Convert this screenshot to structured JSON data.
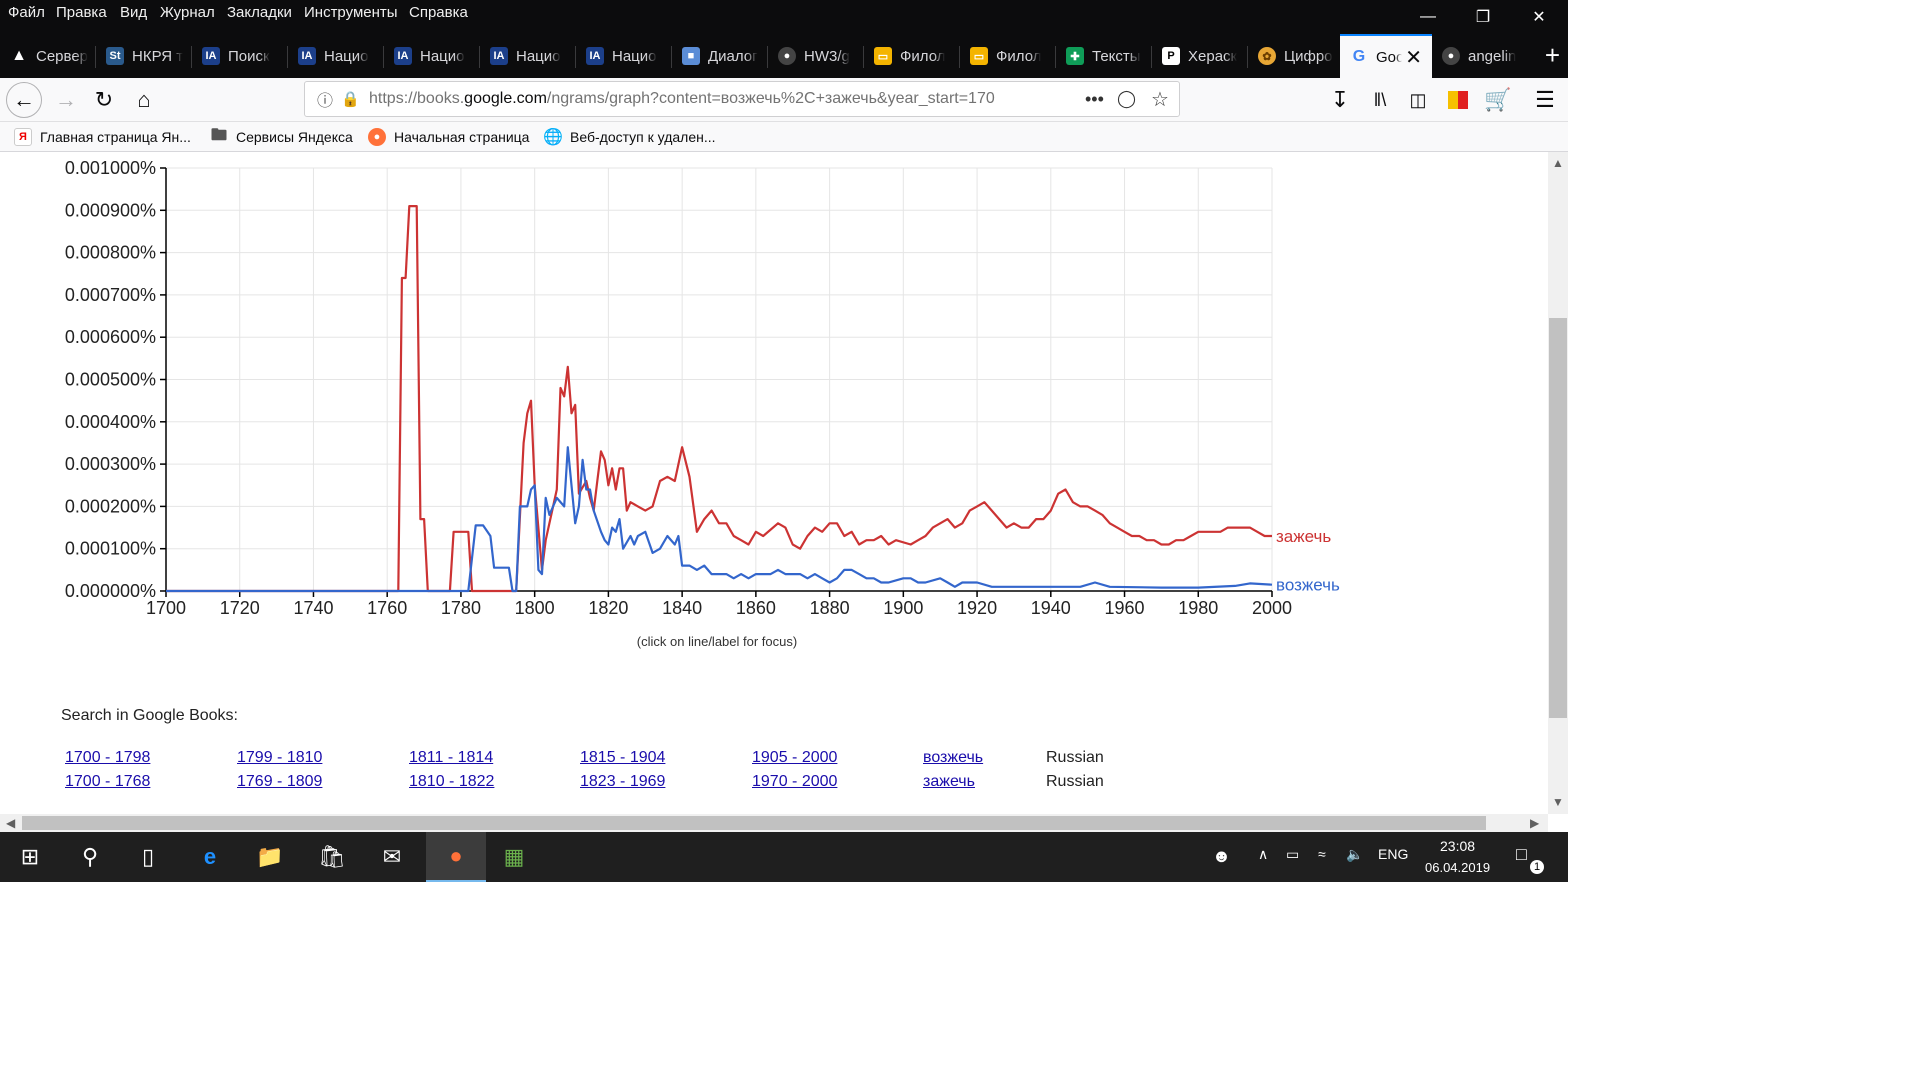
{
  "menu": [
    "Файл",
    "Правка",
    "Вид",
    "Журнал",
    "Закладки",
    "Инструменты",
    "Справка"
  ],
  "tabs": [
    {
      "label": "Сервер",
      "icon": "warning-icon"
    },
    {
      "label": "НКРЯ т",
      "icon": "st-icon"
    },
    {
      "label": "Поиск",
      "icon": "nkrya-icon"
    },
    {
      "label": "Нацио",
      "icon": "nkrya-icon"
    },
    {
      "label": "Нацио",
      "icon": "nkrya-icon"
    },
    {
      "label": "Нацио",
      "icon": "nkrya-icon"
    },
    {
      "label": "Нацио",
      "icon": "nkrya-icon"
    },
    {
      "label": "Диалог",
      "icon": "chat-icon"
    },
    {
      "label": "HW3/g",
      "icon": "github-icon"
    },
    {
      "label": "Филол",
      "icon": "slides-icon"
    },
    {
      "label": "Филол",
      "icon": "slides-icon"
    },
    {
      "label": "Тексты",
      "icon": "sheets-icon"
    },
    {
      "label": "Хераск",
      "icon": "doc-icon"
    },
    {
      "label": "Цифро",
      "icon": "brain-icon"
    },
    {
      "label": "Goo",
      "icon": "google-icon",
      "active": true
    },
    {
      "label": "angelin",
      "icon": "github-icon"
    }
  ],
  "url": {
    "prefix": "https://books.",
    "domain": "google.com",
    "path": "/ngrams/graph?content=возжечь%2C+зажечь&year_start=170"
  },
  "bookmarks": [
    {
      "label": "Главная страница Ян...",
      "icon": "yandex-icon"
    },
    {
      "label": "Сервисы Яндекса",
      "icon": "folder-icon"
    },
    {
      "label": "Начальная страница",
      "icon": "firefox-icon"
    },
    {
      "label": "Веб-доступ к удален...",
      "icon": "globe-icon"
    }
  ],
  "chart_data": {
    "type": "line",
    "x_ticks": [
      1700,
      1720,
      1740,
      1760,
      1780,
      1800,
      1820,
      1840,
      1860,
      1880,
      1900,
      1920,
      1940,
      1960,
      1980,
      2000
    ],
    "y_ticks": [
      "0.000000%",
      "0.000100%",
      "0.000200%",
      "0.000300%",
      "0.000400%",
      "0.000500%",
      "0.000600%",
      "0.000700%",
      "0.000800%",
      "0.000900%",
      "0.001000%"
    ],
    "xlim": [
      1700,
      2000
    ],
    "ylim": [
      0,
      0.001
    ],
    "grid": true,
    "note": "(click on line/label for focus)",
    "series": [
      {
        "name": "зажечь",
        "color": "#cc3333",
        "points": [
          [
            1700,
            0
          ],
          [
            1763,
            0
          ],
          [
            1764,
            0.00074
          ],
          [
            1765,
            0.00074
          ],
          [
            1766,
            0.00091
          ],
          [
            1768,
            0.00091
          ],
          [
            1769,
            0.00017
          ],
          [
            1770,
            0.00017
          ],
          [
            1771,
            0
          ],
          [
            1777,
            0
          ],
          [
            1778,
            0.00014
          ],
          [
            1782,
            0.00014
          ],
          [
            1783,
            0
          ],
          [
            1795,
            0
          ],
          [
            1797,
            0.00035
          ],
          [
            1798,
            0.00042
          ],
          [
            1799,
            0.00045
          ],
          [
            1800,
            0.00025
          ],
          [
            1802,
            5e-05
          ],
          [
            1803,
            0.00012
          ],
          [
            1806,
            0.00024
          ],
          [
            1807,
            0.00048
          ],
          [
            1808,
            0.00046
          ],
          [
            1809,
            0.00053
          ],
          [
            1810,
            0.00042
          ],
          [
            1811,
            0.00044
          ],
          [
            1812,
            0.00023
          ],
          [
            1814,
            0.00026
          ],
          [
            1815,
            0.00022
          ],
          [
            1816,
            0.00019
          ],
          [
            1817,
            0.00026
          ],
          [
            1818,
            0.00033
          ],
          [
            1819,
            0.00031
          ],
          [
            1820,
            0.00025
          ],
          [
            1821,
            0.00029
          ],
          [
            1822,
            0.00024
          ],
          [
            1823,
            0.00029
          ],
          [
            1824,
            0.00029
          ],
          [
            1825,
            0.00019
          ],
          [
            1826,
            0.00021
          ],
          [
            1828,
            0.0002
          ],
          [
            1830,
            0.00019
          ],
          [
            1832,
            0.0002
          ],
          [
            1834,
            0.00026
          ],
          [
            1836,
            0.00027
          ],
          [
            1838,
            0.00026
          ],
          [
            1840,
            0.00034
          ],
          [
            1842,
            0.00027
          ],
          [
            1844,
            0.00014
          ],
          [
            1846,
            0.00017
          ],
          [
            1848,
            0.00019
          ],
          [
            1850,
            0.00016
          ],
          [
            1852,
            0.00016
          ],
          [
            1854,
            0.00013
          ],
          [
            1856,
            0.00012
          ],
          [
            1858,
            0.00011
          ],
          [
            1860,
            0.00014
          ],
          [
            1862,
            0.00013
          ],
          [
            1866,
            0.00016
          ],
          [
            1868,
            0.00015
          ],
          [
            1870,
            0.00011
          ],
          [
            1872,
            0.0001
          ],
          [
            1874,
            0.00013
          ],
          [
            1876,
            0.00015
          ],
          [
            1878,
            0.00014
          ],
          [
            1880,
            0.00016
          ],
          [
            1882,
            0.00016
          ],
          [
            1884,
            0.00013
          ],
          [
            1886,
            0.00014
          ],
          [
            1888,
            0.00011
          ],
          [
            1890,
            0.00012
          ],
          [
            1892,
            0.00012
          ],
          [
            1894,
            0.00013
          ],
          [
            1896,
            0.00011
          ],
          [
            1898,
            0.00012
          ],
          [
            1902,
            0.00011
          ],
          [
            1904,
            0.00012
          ],
          [
            1906,
            0.00013
          ],
          [
            1908,
            0.00015
          ],
          [
            1910,
            0.00016
          ],
          [
            1912,
            0.00017
          ],
          [
            1914,
            0.00015
          ],
          [
            1916,
            0.00016
          ],
          [
            1918,
            0.00019
          ],
          [
            1920,
            0.0002
          ],
          [
            1922,
            0.00021
          ],
          [
            1924,
            0.00019
          ],
          [
            1926,
            0.00017
          ],
          [
            1928,
            0.00015
          ],
          [
            1930,
            0.00016
          ],
          [
            1932,
            0.00015
          ],
          [
            1934,
            0.00015
          ],
          [
            1936,
            0.00017
          ],
          [
            1938,
            0.00017
          ],
          [
            1940,
            0.00019
          ],
          [
            1942,
            0.00023
          ],
          [
            1944,
            0.00024
          ],
          [
            1946,
            0.00021
          ],
          [
            1948,
            0.0002
          ],
          [
            1950,
            0.0002
          ],
          [
            1952,
            0.00019
          ],
          [
            1954,
            0.00018
          ],
          [
            1956,
            0.00016
          ],
          [
            1958,
            0.00015
          ],
          [
            1960,
            0.00014
          ],
          [
            1962,
            0.00013
          ],
          [
            1964,
            0.00013
          ],
          [
            1966,
            0.00012
          ],
          [
            1968,
            0.00012
          ],
          [
            1970,
            0.00011
          ],
          [
            1972,
            0.00011
          ],
          [
            1974,
            0.00012
          ],
          [
            1976,
            0.00012
          ],
          [
            1978,
            0.00013
          ],
          [
            1980,
            0.00014
          ],
          [
            1982,
            0.00014
          ],
          [
            1984,
            0.00014
          ],
          [
            1986,
            0.00014
          ],
          [
            1988,
            0.00015
          ],
          [
            1990,
            0.00015
          ],
          [
            1992,
            0.00015
          ],
          [
            1994,
            0.00015
          ],
          [
            1996,
            0.00014
          ],
          [
            1998,
            0.00013
          ],
          [
            2000,
            0.00013
          ]
        ]
      },
      {
        "name": "возжечь",
        "color": "#3366cc",
        "points": [
          [
            1700,
            0
          ],
          [
            1782,
            0
          ],
          [
            1784,
            0.000155
          ],
          [
            1786,
            0.000155
          ],
          [
            1788,
            0.00013
          ],
          [
            1789,
            5.5e-05
          ],
          [
            1793,
            5.5e-05
          ],
          [
            1794,
            0
          ],
          [
            1795,
            0
          ],
          [
            1796,
            0.0002
          ],
          [
            1798,
            0.0002
          ],
          [
            1799,
            0.00024
          ],
          [
            1800,
            0.00025
          ],
          [
            1801,
            5e-05
          ],
          [
            1802,
            4e-05
          ],
          [
            1803,
            0.00022
          ],
          [
            1804,
            0.00018
          ],
          [
            1806,
            0.00022
          ],
          [
            1808,
            0.0002
          ],
          [
            1809,
            0.00034
          ],
          [
            1810,
            0.00025
          ],
          [
            1811,
            0.00016
          ],
          [
            1812,
            0.0002
          ],
          [
            1813,
            0.00031
          ],
          [
            1814,
            0.00024
          ],
          [
            1815,
            0.00024
          ],
          [
            1816,
            0.00019
          ],
          [
            1818,
            0.00014
          ],
          [
            1819,
            0.00012
          ],
          [
            1820,
            0.00011
          ],
          [
            1821,
            0.00015
          ],
          [
            1822,
            0.00014
          ],
          [
            1823,
            0.00017
          ],
          [
            1824,
            0.0001
          ],
          [
            1826,
            0.00013
          ],
          [
            1827,
            0.00011
          ],
          [
            1828,
            0.00013
          ],
          [
            1830,
            0.00014
          ],
          [
            1832,
            9e-05
          ],
          [
            1834,
            0.0001
          ],
          [
            1836,
            0.00013
          ],
          [
            1838,
            0.00011
          ],
          [
            1839,
            0.00013
          ],
          [
            1840,
            6e-05
          ],
          [
            1842,
            6e-05
          ],
          [
            1844,
            5e-05
          ],
          [
            1846,
            6e-05
          ],
          [
            1848,
            4e-05
          ],
          [
            1850,
            4e-05
          ],
          [
            1852,
            4e-05
          ],
          [
            1854,
            3e-05
          ],
          [
            1856,
            4e-05
          ],
          [
            1858,
            3e-05
          ],
          [
            1860,
            4e-05
          ],
          [
            1862,
            4e-05
          ],
          [
            1864,
            4e-05
          ],
          [
            1866,
            5e-05
          ],
          [
            1868,
            4e-05
          ],
          [
            1870,
            4e-05
          ],
          [
            1872,
            4e-05
          ],
          [
            1874,
            3e-05
          ],
          [
            1876,
            4e-05
          ],
          [
            1878,
            3e-05
          ],
          [
            1880,
            2e-05
          ],
          [
            1882,
            3e-05
          ],
          [
            1884,
            5e-05
          ],
          [
            1886,
            5e-05
          ],
          [
            1888,
            4e-05
          ],
          [
            1890,
            3e-05
          ],
          [
            1892,
            3e-05
          ],
          [
            1894,
            2e-05
          ],
          [
            1896,
            2e-05
          ],
          [
            1900,
            3e-05
          ],
          [
            1902,
            3e-05
          ],
          [
            1904,
            2e-05
          ],
          [
            1906,
            2e-05
          ],
          [
            1910,
            3e-05
          ],
          [
            1912,
            2e-05
          ],
          [
            1914,
            1e-05
          ],
          [
            1916,
            2e-05
          ],
          [
            1920,
            2e-05
          ],
          [
            1924,
            1e-05
          ],
          [
            1930,
            1e-05
          ],
          [
            1940,
            1e-05
          ],
          [
            1944,
            1e-05
          ],
          [
            1948,
            1e-05
          ],
          [
            1952,
            2e-05
          ],
          [
            1956,
            1e-05
          ],
          [
            1970,
            8e-06
          ],
          [
            1980,
            8e-06
          ],
          [
            1990,
            1.2e-05
          ],
          [
            1994,
            1.8e-05
          ],
          [
            2000,
            1.5e-05
          ]
        ]
      }
    ]
  },
  "search_label": "Search in Google Books:",
  "search_rows": [
    {
      "ranges": [
        "1700 - 1798",
        "1799 - 1810",
        "1811 - 1814",
        "1815 - 1904",
        "1905 - 2000"
      ],
      "word": "возжечь",
      "lang": "Russian"
    },
    {
      "ranges": [
        "1700 - 1768",
        "1769 - 1809",
        "1810 - 1822",
        "1823 - 1969",
        "1970 - 2000"
      ],
      "word": "зажечь",
      "lang": "Russian"
    }
  ],
  "taskbar": {
    "lang": "ENG",
    "time": "23:08",
    "date": "06.04.2019",
    "notifications": "1"
  }
}
